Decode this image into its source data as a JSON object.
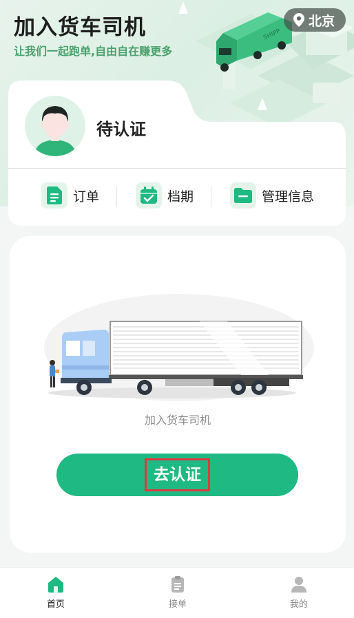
{
  "header": {
    "title": "加入货车司机",
    "subtitle": "让我们一起跑单,自由自在赚更多",
    "city": "北京",
    "location_icon": "location-pin-icon"
  },
  "profile": {
    "status": "待认证",
    "avatar_icon": "driver-avatar",
    "quick_links": [
      {
        "label": "订单",
        "icon": "document-icon"
      },
      {
        "label": "档期",
        "icon": "calendar-check-icon"
      },
      {
        "label": "管理信息",
        "icon": "folder-icon"
      }
    ]
  },
  "main": {
    "caption": "加入货车司机",
    "cta_label": "去认证"
  },
  "nav": {
    "items": [
      {
        "label": "首页",
        "icon": "home-icon",
        "active": true
      },
      {
        "label": "接单",
        "icon": "clipboard-icon",
        "active": false
      },
      {
        "label": "我的",
        "icon": "user-icon",
        "active": false
      }
    ]
  },
  "colors": {
    "accent": "#1fb983",
    "subtitle": "#4aa16c",
    "highlight_border": "#e0393e"
  }
}
